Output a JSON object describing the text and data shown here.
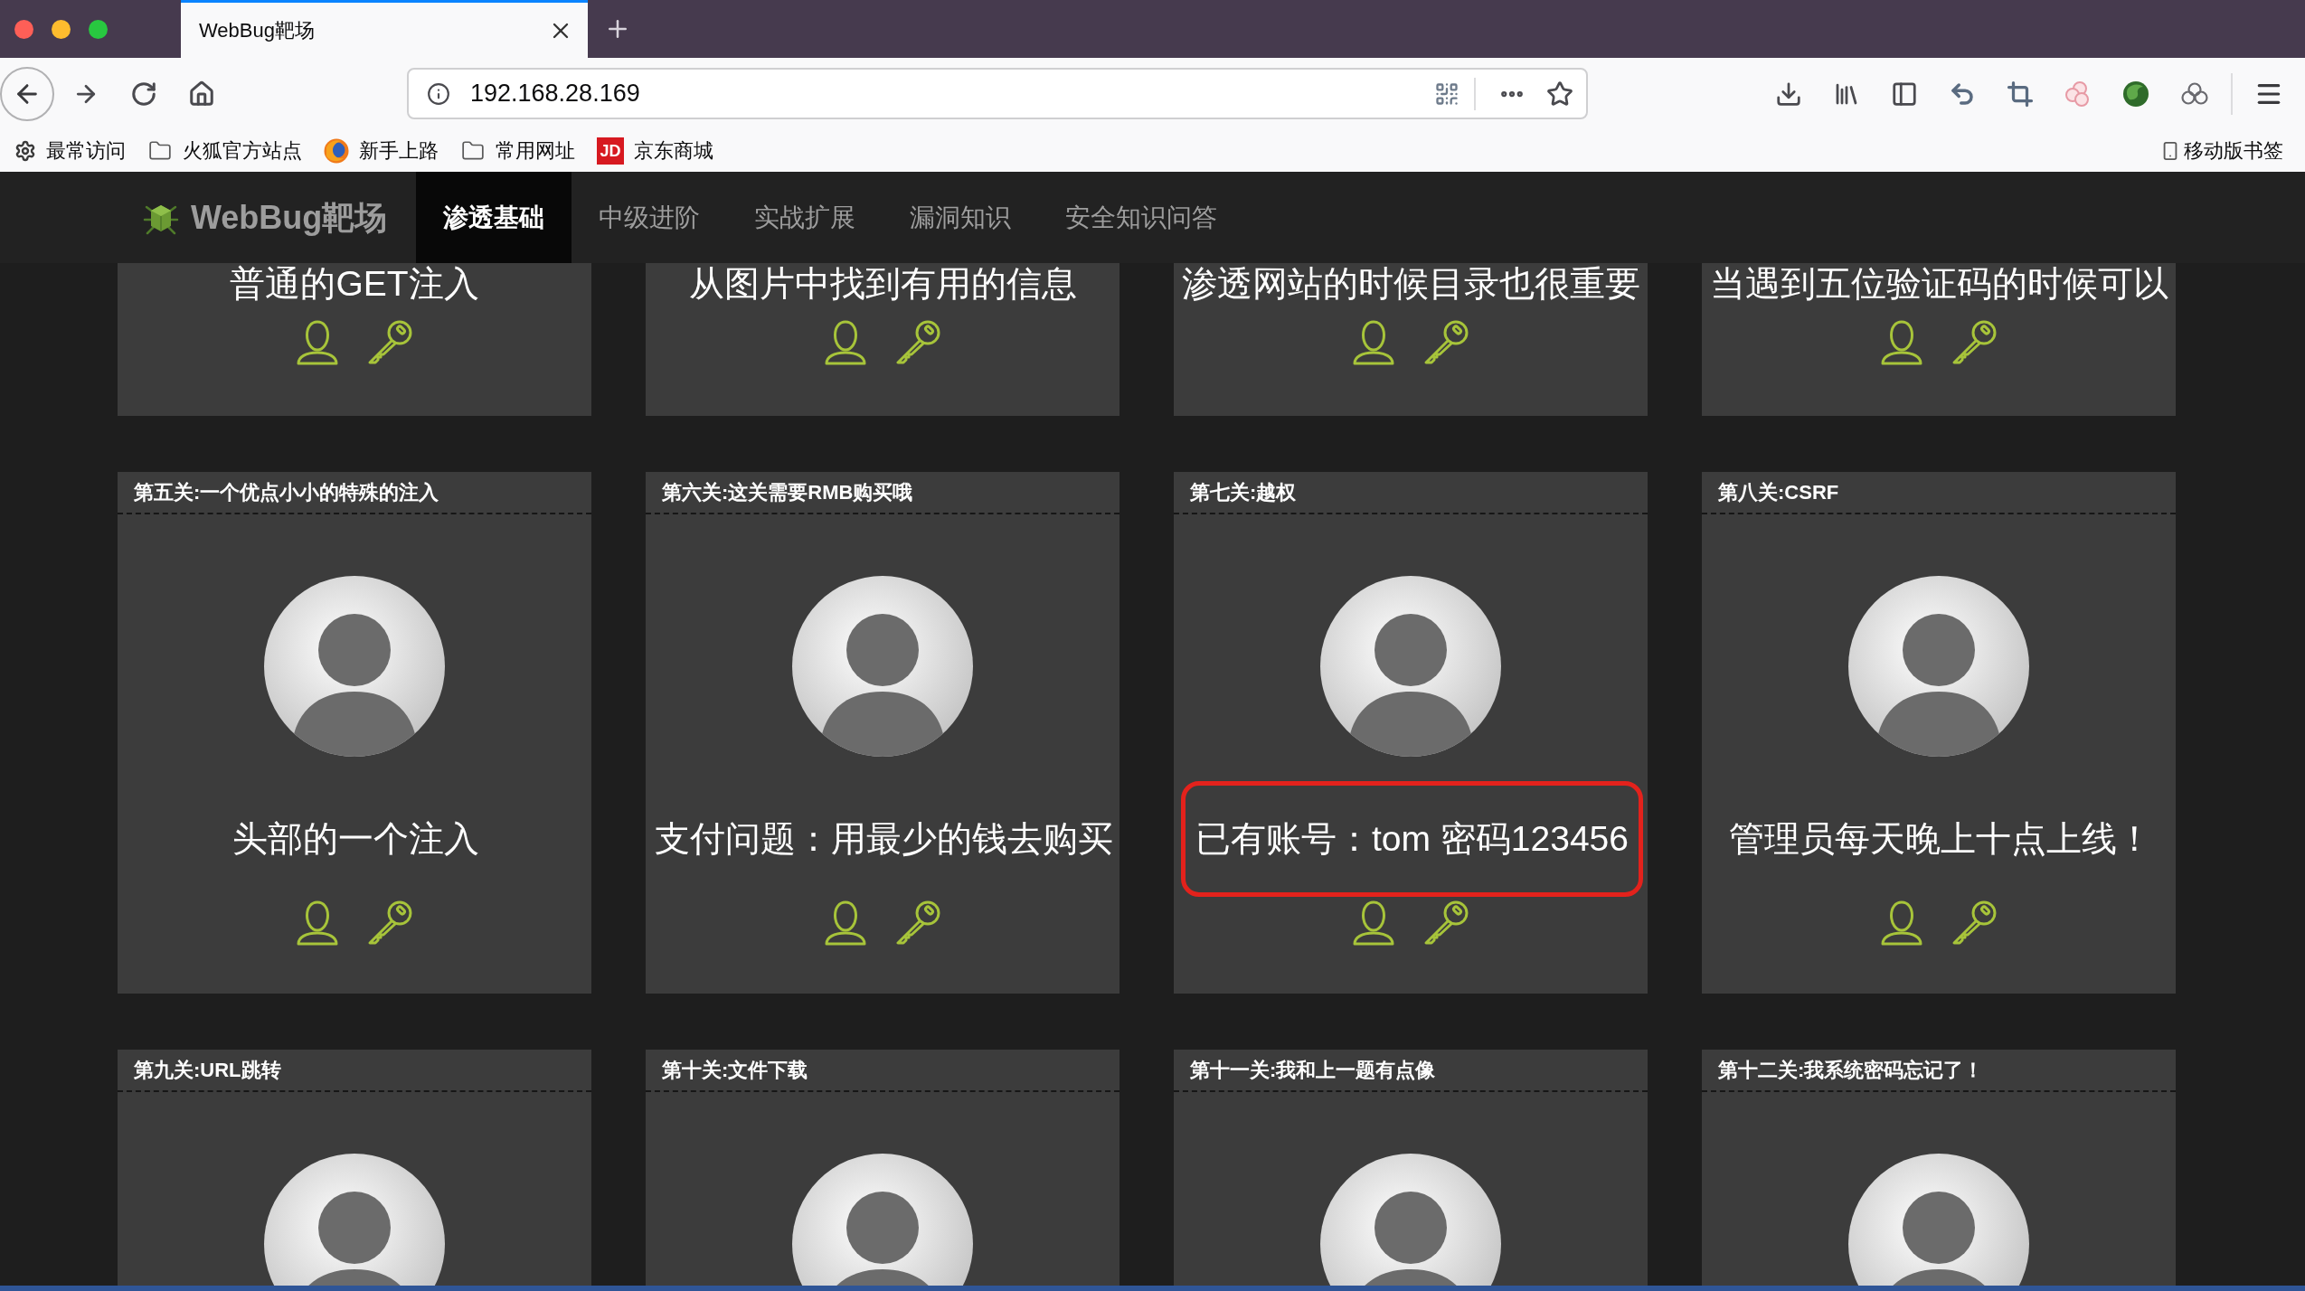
{
  "browser": {
    "tabs": [
      {
        "title": "WebBug靶场",
        "selected": true
      }
    ],
    "address_bar": {
      "url": "192.168.28.169"
    },
    "bookmarks": [
      {
        "kind": "gear",
        "label": "最常访问"
      },
      {
        "kind": "folder",
        "label": "火狐官方站点"
      },
      {
        "kind": "browser",
        "label": "新手上路"
      },
      {
        "kind": "folder",
        "label": "常用网址"
      },
      {
        "kind": "badge",
        "badge": "JD",
        "label": "京东商城"
      }
    ],
    "mobile_bookmarks": {
      "label": "移动版书签"
    }
  },
  "site": {
    "logo": "WebBug靶场",
    "nav": [
      {
        "label": "渗透基础",
        "selected": true
      },
      {
        "label": "中级进阶",
        "selected": false
      },
      {
        "label": "实战扩展",
        "selected": false
      },
      {
        "label": "漏洞知识",
        "selected": false
      },
      {
        "label": "安全知识问答",
        "selected": false
      }
    ]
  },
  "levels": [
    {
      "title": "普通的GET注入"
    },
    {
      "title": "从图片中找到有用的信息"
    },
    {
      "title": "渗透网站的时候目录也很重要"
    },
    {
      "title": "当遇到五位验证码的时候可以"
    },
    {
      "header": "第五关:一个优点小小的特殊的注入",
      "title": "头部的一个注入",
      "highlighted": false
    },
    {
      "header": "第六关:这关需要RMB购买哦",
      "title": "支付问题：用最少的钱去购买",
      "highlighted": false
    },
    {
      "header": "第七关:越权",
      "title": "已有账号：tom 密码123456",
      "highlighted": true
    },
    {
      "header": "第八关:CSRF",
      "title": "管理员每天晚上十点上线！",
      "highlighted": false
    },
    {
      "header": "第九关:URL跳转"
    },
    {
      "header": "第十关:文件下载"
    },
    {
      "header": "第十一关:我和上一题有点像"
    },
    {
      "header": "第十二关:我系统密码忘记了！"
    }
  ]
}
